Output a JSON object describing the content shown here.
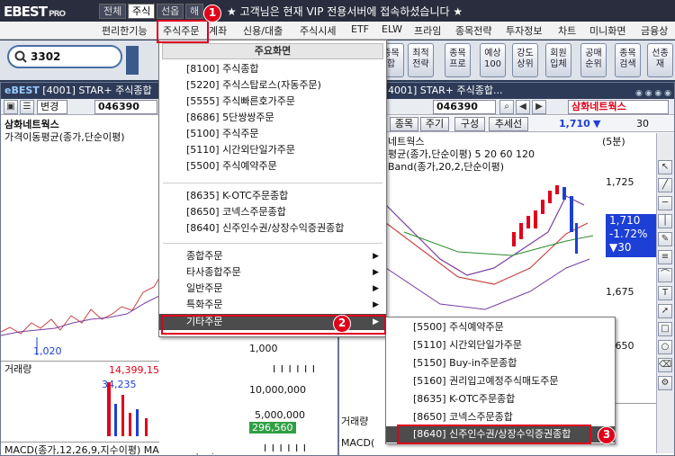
{
  "titlebar": {
    "logo": "EBEST",
    "logo_suffix": "PRO",
    "tabs": [
      "전체",
      "주식",
      "선옵",
      "해"
    ],
    "notice": "★ 고객님은 현재 VIP 전용서버에 접속하셨습니다 ★"
  },
  "menubar": {
    "items": [
      "편리한기능",
      "주식주문",
      "계좌",
      "신용/대출",
      "주식시세",
      "ETF",
      "ELW",
      "프라임",
      "종목전략",
      "투자정보",
      "차트",
      "미니화면",
      "금융상"
    ]
  },
  "toolbar": {
    "search_value": "3302",
    "buttons": [
      "종목\n합",
      "최적\n전략",
      "종목\n프로",
      "예상\n100",
      "강도\n상위",
      "회원\n입체",
      "공매\n순위",
      "종목\n검색",
      "선종\n재"
    ]
  },
  "window_left": {
    "title": "[4001] STAR+ 주식종합",
    "code": "046390",
    "combo": "변경",
    "stock_name": "삼화네트웍스",
    "indicator": "가격이동평균(종가,단순이평)",
    "low_label": "1,020",
    "volume_title": "거래량",
    "volume_peak": "14,399,150",
    "volume_ma": "34,235",
    "volume_axis": [
      "10,000,000",
      "5,000,000"
    ],
    "volume_current": "296,560",
    "price_axis": "1,000",
    "macd": "MACD(종가,12,26,9,지수이평)  MACD Osc(12, 2"
  },
  "window_right": {
    "title": "4001] STAR+ 주식종합...",
    "code": "046390",
    "name": "삼화네트웍스",
    "tabs": [
      "종목",
      "주기",
      "구성",
      "추세선"
    ],
    "price": "1,710",
    "change": "30",
    "period": "(5분)",
    "chart_name": "네트웍스",
    "indicator": "평균(종가,단순이평) 5 20 60 120",
    "band": "Band(종가,20,2,단순이평)",
    "price_labels": [
      "1,725",
      "1,700",
      "1,675",
      "1,650"
    ],
    "price_tag": "1,710",
    "pct_tag": "-1.72%",
    "change_tag": "▼30",
    "volume_title": "거래량",
    "macd": "MACD("
  },
  "main_menu": {
    "header": "주요화면",
    "items": [
      "[8100] 주식종합",
      "[5220] 주식스탑로스(자동주문)",
      "[5555] 주식빠른호가주문",
      "[8686] 5단쌍쌍주문",
      "[5100] 주식주문",
      "[5110] 시간외단일가주문",
      "[5500] 주식예약주문"
    ],
    "items2": [
      "[8635] K-OTC주문종합",
      "[8650] 코넥스주문종합",
      "[8640] 신주인수권/상장수익증권종합"
    ],
    "submenus": [
      "종합주문",
      "타사종합주문",
      "일반주문",
      "특화주문",
      "기타주문"
    ]
  },
  "sub_menu": {
    "items": [
      "[5500] 주식예약주문",
      "[5110] 시간외단일가주문",
      "[5150] Buy-in주문종합",
      "[5160] 권리입고예정주식매도주문",
      "[8635] K-OTC주문종합",
      "[8650] 코넥스주문종합",
      "[8640] 신주인수권/상장수익증권종합"
    ]
  },
  "annotations": [
    "1",
    "2",
    "3"
  ],
  "colors": {
    "highlight": "#e0001b",
    "up": "#e0001b",
    "down": "#1c3fd6"
  }
}
